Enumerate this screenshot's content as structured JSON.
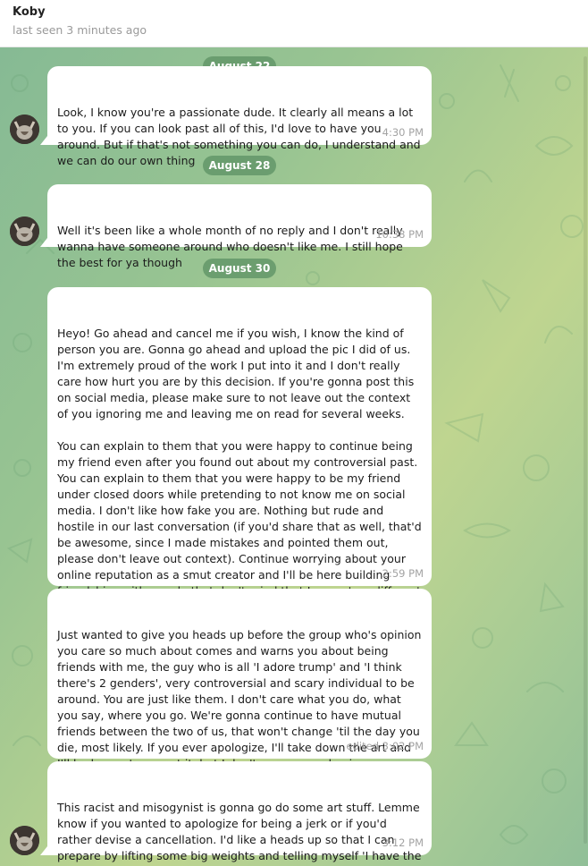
{
  "header": {
    "contact_name": "Koby",
    "status": "last seen 3 minutes ago"
  },
  "dates": [
    "August 22",
    "August 28",
    "August 30"
  ],
  "messages": [
    {
      "text": "Look, I know you're a passionate dude. It clearly all means a lot to you. If you can look past all of this, I'd love to have you around. But if that's not something you can do, I understand and we can do our own thing",
      "time": "4:30 PM"
    },
    {
      "text": "Well it's been like a whole month of no reply and I don't really wanna have someone around who doesn't like me. I still hope the best for ya though",
      "time": "10:38 PM"
    },
    {
      "text": "Heyo! Go ahead and cancel me if you wish, I know the kind of person you are. Gonna go ahead and upload the pic I did of us. I'm extremely proud of the work I put into it and I don't really care how hurt you are by this decision. If you're gonna post this on social media, please make sure to not leave out the context of you ignoring me and leaving me on read for several weeks.\n\nYou can explain to them that you were happy to continue being my friend even after you found out about my controversial past. You can explain to them that you were happy to be my friend under closed doors while pretending to not know me on social media. I don't like how fake you are. Nothing but rude and hostile in our last conversation (if you'd share that as well, that'd be awesome, since I made mistakes and pointed them out, please don't leave out context). Continue worrying about your online reputation as a smut creator and I'll be here building friendships with people that don't mind that I came to a different conclusion ideologically than them.",
      "time": "2:59 PM"
    },
    {
      "text": "Just wanted to give you heads up before the group who's opinion you care so much about comes and warns you about being friends with me, the guy who is all 'I adore trump' and 'I think there's 2 genders', very controversial and scary individual to be around. You are just like them. I don't care what you do, what you say, where you go. We're gonna continue to have mutual friends between the two of us, that won't change 'til the day you die, most likely. If you ever apologize, I'll take down the art and I'll be happy to accept it, but I don't see us ever having a sustainable relationship again.",
      "time": "edited 3:02 PM"
    },
    {
      "text": "This racist and misogynist is gonna go do some art stuff. Lemme know if you wanted to apologize for being a jerk or if you'd rather devise a cancellation. I'd like a heads up so that I can prepare by lifting some big weights and telling myself 'I have the stronger moral compass' in the mirror to feel better about myself.",
      "time": "3:12 PM"
    }
  ],
  "colors": {
    "chat_bg_start": "#86ba94",
    "chat_bg_mid": "#bfd590",
    "date_pill": "#639668",
    "bubble_bg": "#ffffff",
    "time_text": "#a3a3a3"
  },
  "icons": [
    "contact-avatar"
  ]
}
